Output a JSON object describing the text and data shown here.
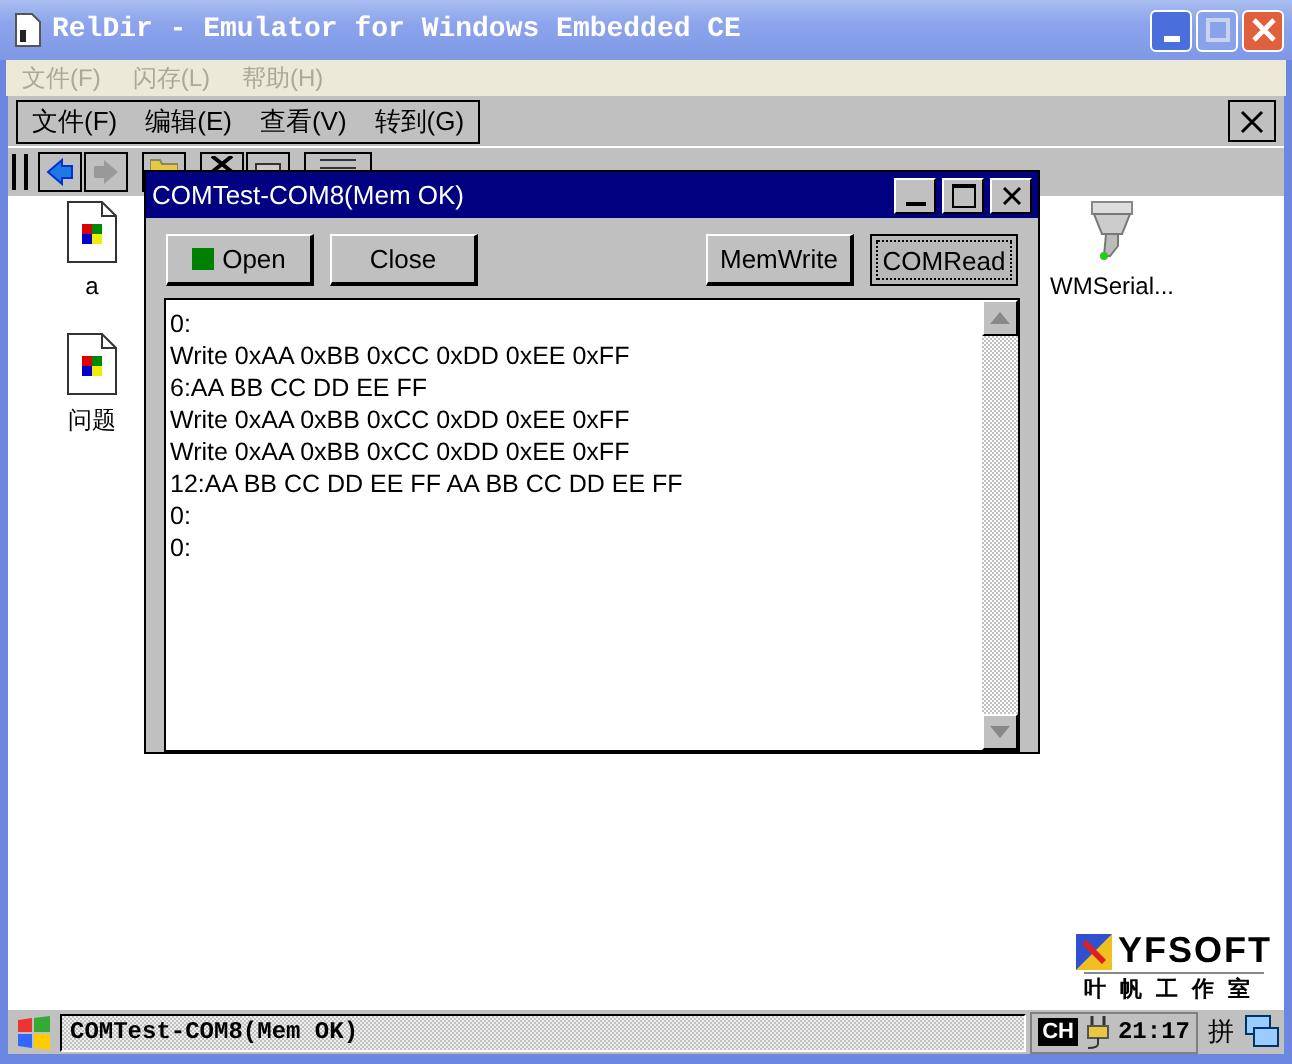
{
  "window": {
    "title": "RelDir - Emulator for Windows Embedded CE"
  },
  "menu": [
    {
      "label": "文件(F)",
      "disabled": true
    },
    {
      "label": "闪存(L)",
      "disabled": true
    },
    {
      "label": "帮助(H)",
      "disabled": true
    }
  ],
  "ce_menu": [
    "文件(F)",
    "编辑(E)",
    "查看(V)",
    "转到(G)"
  ],
  "desktop_icons": [
    {
      "label": "a",
      "kind": "document"
    },
    {
      "label": "问题",
      "kind": "document"
    },
    {
      "label": "WMSerial...",
      "kind": "serial"
    }
  ],
  "dialog": {
    "title": "COMTest-COM8(Mem OK)",
    "buttons": [
      {
        "label": "Open",
        "kind": "lamp",
        "focused": false
      },
      {
        "label": "Close",
        "kind": "plain",
        "focused": false
      },
      {
        "label": "MemWrite",
        "kind": "plain",
        "focused": false
      },
      {
        "label": "COMRead",
        "kind": "plain",
        "focused": true
      }
    ],
    "log": [
      "0:",
      "Write 0xAA 0xBB 0xCC 0xDD 0xEE 0xFF",
      "6:AA BB CC DD EE FF",
      "Write 0xAA 0xBB 0xCC 0xDD 0xEE 0xFF",
      "Write 0xAA 0xBB 0xCC 0xDD 0xEE 0xFF",
      "12:AA BB CC DD EE FF AA BB CC DD EE FF",
      "0:",
      "0:"
    ]
  },
  "logo": {
    "name": "YFSOFT",
    "subtitle": "叶帆工作室"
  },
  "taskbar": {
    "task": "COMTest-COM8(Mem OK)",
    "ime": "CH",
    "clock": "21:17",
    "input_mode": "拼"
  }
}
